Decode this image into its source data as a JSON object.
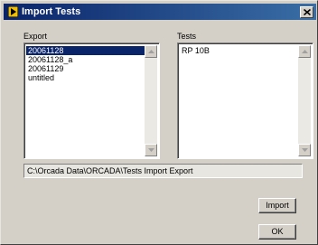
{
  "window": {
    "title": "Import Tests"
  },
  "export_panel": {
    "label": "Export",
    "items": [
      "20061128",
      "20061128_a",
      "20061129",
      "untitled"
    ],
    "selected_index": 0
  },
  "tests_panel": {
    "label": "Tests",
    "items": [
      "RP 10B"
    ]
  },
  "path_field": {
    "value": "C:\\Orcada Data\\ORCADA\\Tests Import Export"
  },
  "buttons": {
    "import_label": "Import",
    "ok_label": "OK"
  },
  "colors": {
    "titlebar_start": "#0a246a",
    "titlebar_end": "#3a6ea5",
    "selection": "#0a246a",
    "face": "#d4d0c8"
  },
  "icons": {
    "app": "play-arrow-icon",
    "close": "close-x-icon",
    "scroll_up": "arrow-up-icon",
    "scroll_down": "arrow-down-icon"
  }
}
